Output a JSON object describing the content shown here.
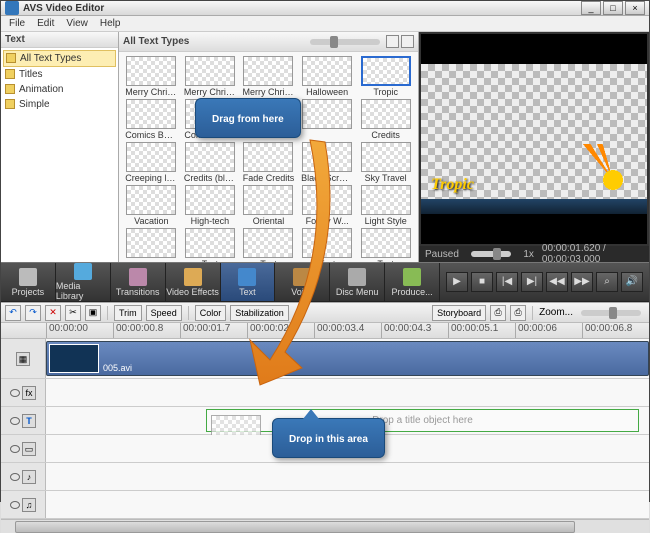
{
  "window": {
    "title": "AVS Video Editor",
    "min": "_",
    "max": "□",
    "close": "×"
  },
  "menu": [
    "File",
    "Edit",
    "View",
    "Help"
  ],
  "sidebar": {
    "header": "Text",
    "items": [
      {
        "label": "All Text Types",
        "selected": true
      },
      {
        "label": "Titles"
      },
      {
        "label": "Animation"
      },
      {
        "label": "Simple"
      }
    ]
  },
  "gallery": {
    "header": "All Text Types",
    "items": [
      {
        "label": "Merry Christ..."
      },
      {
        "label": "Merry Christ..."
      },
      {
        "label": "Merry Christ..."
      },
      {
        "label": "Halloween"
      },
      {
        "label": "Tropic",
        "selected": true
      },
      {
        "label": "Comics Ballo..."
      },
      {
        "label": "Comics Ba..."
      },
      {
        "label": ""
      },
      {
        "label": ""
      },
      {
        "label": "Credits"
      },
      {
        "label": "Creeping line"
      },
      {
        "label": "Credits (black)"
      },
      {
        "label": "Fade Credits"
      },
      {
        "label": "Black Screen..."
      },
      {
        "label": "Sky Travel"
      },
      {
        "label": "Vacation"
      },
      {
        "label": "High-tech"
      },
      {
        "label": "Oriental"
      },
      {
        "label": "Foggy W..."
      },
      {
        "label": "Light Style"
      },
      {
        "label": ""
      },
      {
        "label": "Text"
      },
      {
        "label": "Text"
      },
      {
        "label": "Text"
      },
      {
        "label": "Text"
      }
    ]
  },
  "preview": {
    "overlay": "Tropic",
    "status": "Paused",
    "speed": "1x",
    "time": "00:00:01.620 / 00:00:03.000"
  },
  "toolbar": [
    {
      "label": "Projects",
      "ic": "proj"
    },
    {
      "label": "Media Library",
      "ic": "med"
    },
    {
      "label": "Transitions",
      "ic": "tra"
    },
    {
      "label": "Video Effects",
      "ic": "vfx"
    },
    {
      "label": "Text",
      "ic": "txt",
      "selected": true
    },
    {
      "label": "Voice",
      "ic": "voi"
    },
    {
      "label": "Disc Menu",
      "ic": "dsc"
    },
    {
      "label": "Produce...",
      "ic": "pro"
    }
  ],
  "transport": [
    "▶",
    "■",
    "|◀",
    "▶|",
    "◀◀",
    "▶▶",
    "⌕",
    "🔊"
  ],
  "timelineTools": {
    "left": [
      "↶",
      "↷",
      "✕",
      "✂",
      "▣"
    ],
    "mid": [
      "Trim",
      "Speed",
      "Color",
      "Stabilization"
    ],
    "right": [
      "Storyboard",
      "⎙",
      "⎙",
      "Zoom..."
    ]
  },
  "ruler": [
    "00:00:00",
    "00:00:00.8",
    "00:00:01.7",
    "00:00:02.5",
    "00:00:03.4",
    "00:00:04.3",
    "00:00:05.1",
    "00:00:06",
    "00:00:06.8"
  ],
  "clip": {
    "name": "005.avi"
  },
  "dropzone": "Drop a title object here",
  "callouts": {
    "drag": "Drag from here",
    "drop": "Drop in this area"
  }
}
